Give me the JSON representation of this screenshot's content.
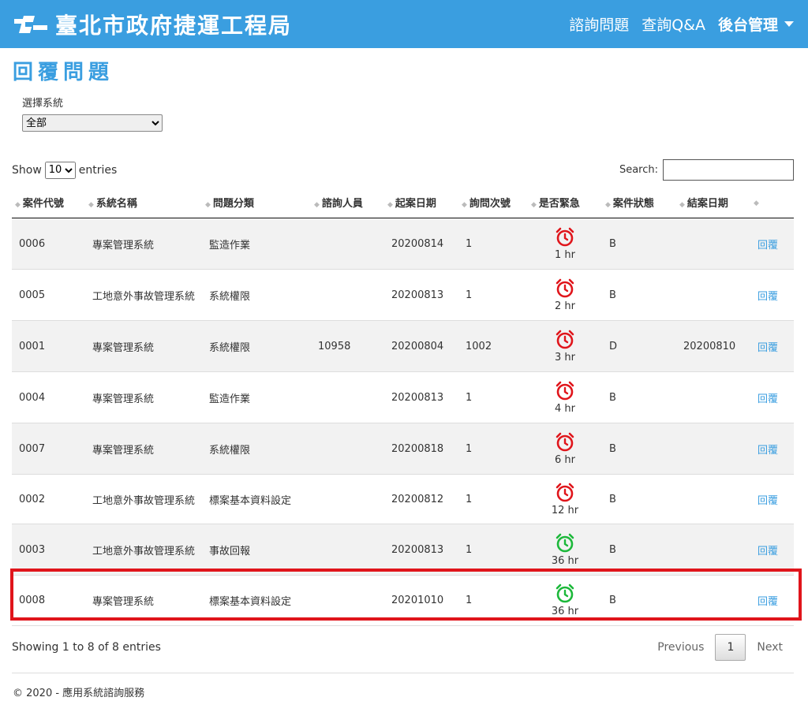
{
  "header": {
    "brand": "臺北市政府捷運工程局",
    "nav": [
      "諮詢問題",
      "查詢Q&A"
    ],
    "admin": "後台管理"
  },
  "page": {
    "title": "回覆問題"
  },
  "filter": {
    "label": "選擇系統",
    "selected": "全部"
  },
  "length": {
    "show": "Show",
    "value": "10",
    "entries": "entries"
  },
  "search": {
    "label": "Search:",
    "value": ""
  },
  "columns": [
    "案件代號",
    "系統名稱",
    "問題分類",
    "諮詢人員",
    "起案日期",
    "詢問次號",
    "是否緊急",
    "案件狀態",
    "結案日期",
    ""
  ],
  "rows": [
    {
      "id": "0006",
      "sys": "專案管理系統",
      "cat": "監造作業",
      "person": "",
      "date": "20200814",
      "times": "1",
      "hrs": "1 hr",
      "status": "B",
      "close": "",
      "reply": "回覆",
      "color": "#e0151b"
    },
    {
      "id": "0005",
      "sys": "工地意外事故管理系統",
      "cat": "系統權限",
      "person": "",
      "date": "20200813",
      "times": "1",
      "hrs": "2 hr",
      "status": "B",
      "close": "",
      "reply": "回覆",
      "color": "#e0151b"
    },
    {
      "id": "0001",
      "sys": "專案管理系統",
      "cat": "系統權限",
      "person": "10958",
      "date": "20200804",
      "times": "1002",
      "hrs": "3 hr",
      "status": "D",
      "close": "20200810",
      "reply": "回覆",
      "color": "#e0151b"
    },
    {
      "id": "0004",
      "sys": "專案管理系統",
      "cat": "監造作業",
      "person": "",
      "date": "20200813",
      "times": "1",
      "hrs": "4 hr",
      "status": "B",
      "close": "",
      "reply": "回覆",
      "color": "#e0151b"
    },
    {
      "id": "0007",
      "sys": "專案管理系統",
      "cat": "系統權限",
      "person": "",
      "date": "20200818",
      "times": "1",
      "hrs": "6 hr",
      "status": "B",
      "close": "",
      "reply": "回覆",
      "color": "#e0151b"
    },
    {
      "id": "0002",
      "sys": "工地意外事故管理系統",
      "cat": "標案基本資料設定",
      "person": "",
      "date": "20200812",
      "times": "1",
      "hrs": "12 hr",
      "status": "B",
      "close": "",
      "reply": "回覆",
      "color": "#e0151b"
    },
    {
      "id": "0003",
      "sys": "工地意外事故管理系統",
      "cat": "事故回報",
      "person": "",
      "date": "20200813",
      "times": "1",
      "hrs": "36 hr",
      "status": "B",
      "close": "",
      "reply": "回覆",
      "color": "#1cb83a"
    },
    {
      "id": "0008",
      "sys": "專案管理系統",
      "cat": "標案基本資料設定",
      "person": "",
      "date": "20201010",
      "times": "1",
      "hrs": "36 hr",
      "status": "B",
      "close": "",
      "reply": "回覆",
      "color": "#1cb83a"
    }
  ],
  "info": "Showing 1 to 8 of 8 entries",
  "pager": {
    "previous": "Previous",
    "current": "1",
    "next": "Next"
  },
  "footer": {
    "copyright": "© 2020 - 應用系統諮詢服務"
  }
}
